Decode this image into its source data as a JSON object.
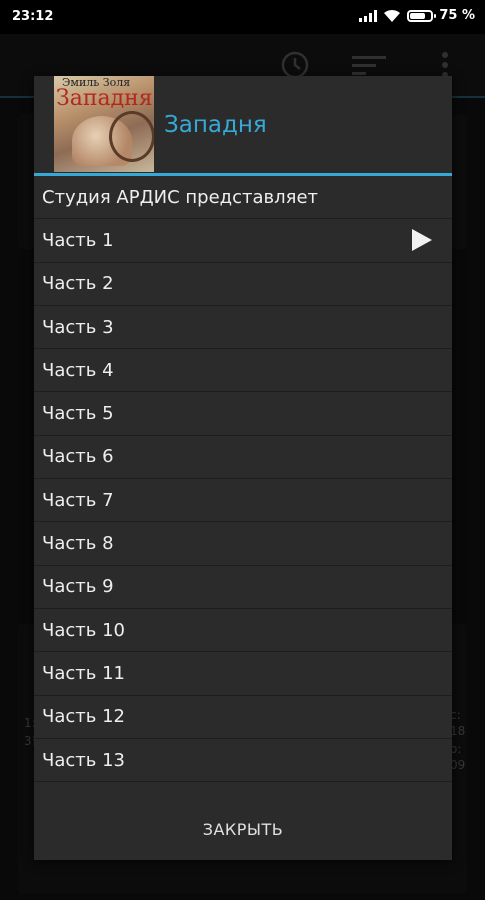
{
  "status_bar": {
    "time": "23:12",
    "battery_text": "75 %",
    "battery_level": 0.75
  },
  "background_app": {
    "icons": [
      "clock-icon",
      "sort-icon",
      "more-icon"
    ],
    "partial_texts": [
      "1:",
      "3!",
      "с:",
      "18",
      "о:",
      "09"
    ]
  },
  "dialog": {
    "title": "Западня",
    "cover": {
      "author": "Эмиль Золя",
      "title": "Западня"
    },
    "items": [
      {
        "label": "Студия АРДИС представляет",
        "playing": false
      },
      {
        "label": "Часть 1",
        "playing": true
      },
      {
        "label": "Часть 2",
        "playing": false
      },
      {
        "label": "Часть 3",
        "playing": false
      },
      {
        "label": "Часть 4",
        "playing": false
      },
      {
        "label": "Часть 5",
        "playing": false
      },
      {
        "label": "Часть 6",
        "playing": false
      },
      {
        "label": "Часть 7",
        "playing": false
      },
      {
        "label": "Часть 8",
        "playing": false
      },
      {
        "label": "Часть 9",
        "playing": false
      },
      {
        "label": "Часть 10",
        "playing": false
      },
      {
        "label": "Часть 11",
        "playing": false
      },
      {
        "label": "Часть 12",
        "playing": false
      },
      {
        "label": "Часть 13",
        "playing": false
      }
    ],
    "close_label": "ЗАКРЫТЬ"
  },
  "colors": {
    "accent": "#36a9d6",
    "dialog_bg": "#2b2b2b",
    "text": "#eeeeee"
  }
}
